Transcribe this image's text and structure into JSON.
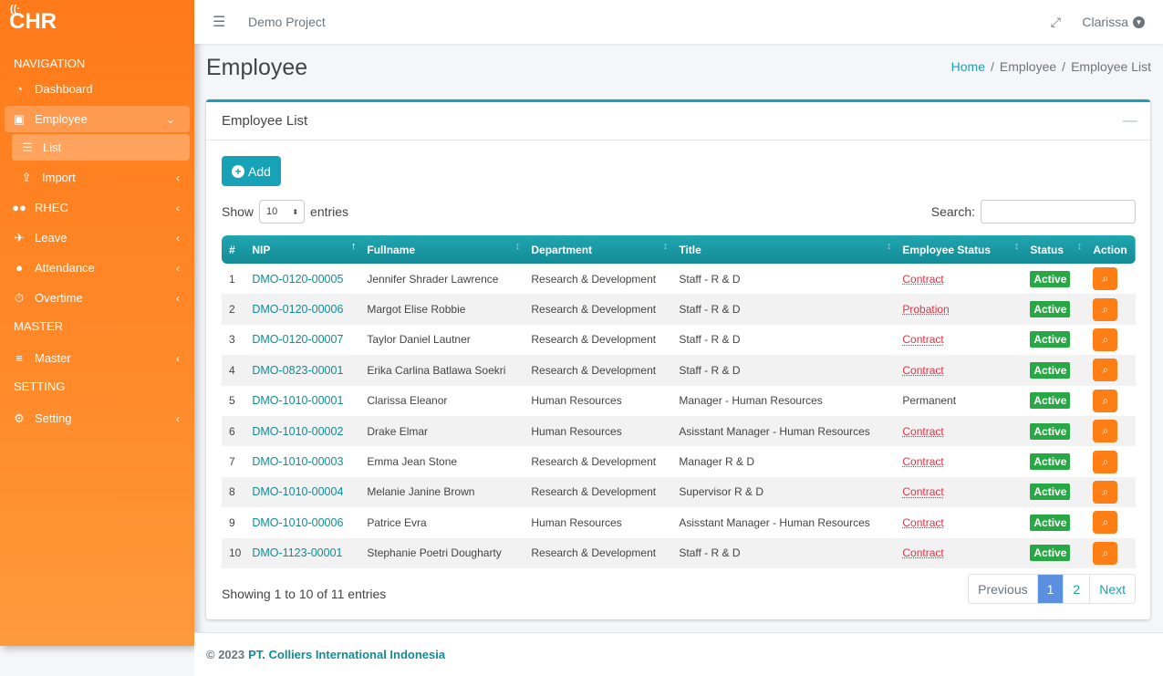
{
  "brand": {
    "logo": "CHR"
  },
  "sidebar": {
    "headers": [
      "NAVIGATION",
      "MASTER",
      "SETTING"
    ],
    "items": [
      {
        "label": "Dashboard",
        "icon": "dashboard-icon"
      },
      {
        "label": "Employee",
        "icon": "id-badge-icon"
      },
      {
        "label": "List",
        "icon": "list-icon"
      },
      {
        "label": "Import",
        "icon": "upload-icon"
      },
      {
        "label": "RHEC",
        "icon": "users-icon"
      },
      {
        "label": "Leave",
        "icon": "plane-icon"
      },
      {
        "label": "Attendance",
        "icon": "user-clock-icon"
      },
      {
        "label": "Overtime",
        "icon": "stopwatch-icon"
      },
      {
        "label": "Master",
        "icon": "database-icon"
      },
      {
        "label": "Setting",
        "icon": "cogs-icon"
      }
    ]
  },
  "topbar": {
    "project": "Demo Project",
    "user": "Clarissa"
  },
  "page": {
    "title": "Employee",
    "breadcrumb": [
      "Home",
      "Employee",
      "Employee List"
    ]
  },
  "card": {
    "title": "Employee List",
    "add_label": "Add",
    "show_label": "Show",
    "entries_value": "10",
    "entries_label": "entries",
    "search_label": "Search:",
    "info": "Showing 1 to 10 of 11 entries",
    "pagination": [
      "Previous",
      "1",
      "2",
      "Next"
    ]
  },
  "table": {
    "columns": [
      "#",
      "NIP",
      "Fullname",
      "Department",
      "Title",
      "Employee Status",
      "Status",
      "Action"
    ],
    "rows": [
      {
        "no": "1",
        "nip": "DMO-0120-00005",
        "name": "Jennifer Shrader Lawrence",
        "dept": "Research & Development",
        "title": "Staff - R & D",
        "emp_status": "Contract",
        "status": "Active"
      },
      {
        "no": "2",
        "nip": "DMO-0120-00006",
        "name": "Margot Elise Robbie",
        "dept": "Research & Development",
        "title": "Staff - R & D",
        "emp_status": "Probation",
        "status": "Active"
      },
      {
        "no": "3",
        "nip": "DMO-0120-00007",
        "name": "Taylor Daniel Lautner",
        "dept": "Research & Development",
        "title": "Staff - R & D",
        "emp_status": "Contract",
        "status": "Active"
      },
      {
        "no": "4",
        "nip": "DMO-0823-00001",
        "name": "Erika Carlina Batlawa Soekri",
        "dept": "Research & Development",
        "title": "Staff - R & D",
        "emp_status": "Contract",
        "status": "Active"
      },
      {
        "no": "5",
        "nip": "DMO-1010-00001",
        "name": "Clarissa Eleanor",
        "dept": "Human Resources",
        "title": "Manager - Human Resources",
        "emp_status": "Permanent",
        "status": "Active"
      },
      {
        "no": "6",
        "nip": "DMO-1010-00002",
        "name": "Drake Elmar",
        "dept": "Human Resources",
        "title": "Asisstant Manager - Human Resources",
        "emp_status": "Contract",
        "status": "Active"
      },
      {
        "no": "7",
        "nip": "DMO-1010-00003",
        "name": "Emma Jean Stone",
        "dept": "Research & Development",
        "title": "Manager R & D",
        "emp_status": "Contract",
        "status": "Active"
      },
      {
        "no": "8",
        "nip": "DMO-1010-00004",
        "name": "Melanie Janine Brown",
        "dept": "Research & Development",
        "title": "Supervisor R & D",
        "emp_status": "Contract",
        "status": "Active"
      },
      {
        "no": "9",
        "nip": "DMO-1010-00006",
        "name": "Patrice Evra",
        "dept": "Human Resources",
        "title": "Asisstant Manager - Human Resources",
        "emp_status": "Contract",
        "status": "Active"
      },
      {
        "no": "10",
        "nip": "DMO-1123-00001",
        "name": "Stephanie Poetri Dougharty",
        "dept": "Research & Development",
        "title": "Staff - R & D",
        "emp_status": "Contract",
        "status": "Active"
      }
    ]
  },
  "footer": {
    "copyright": "© 2023",
    "company": "PT. Colliers International Indonesia"
  },
  "colors": {
    "accent": "#17a2b8",
    "sidebar": "#ff7a1a",
    "active": "#28a745",
    "action": "#fd7e14",
    "contract": "#dc3545"
  }
}
